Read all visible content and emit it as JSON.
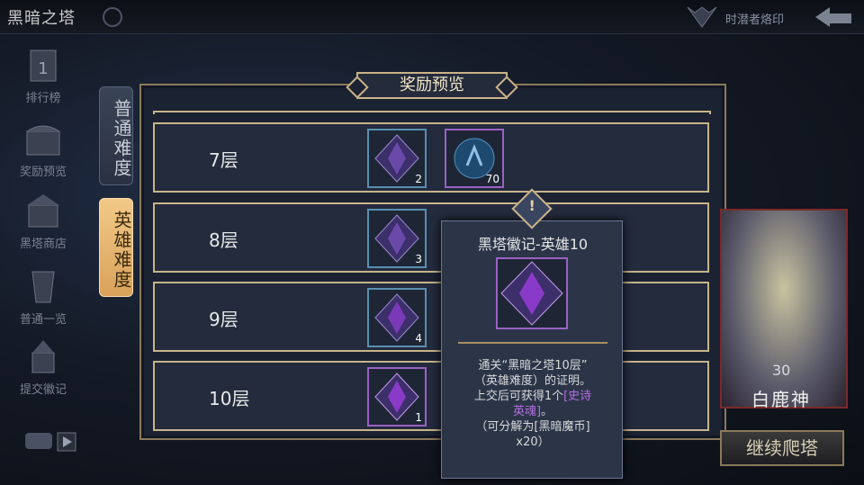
{
  "header": {
    "title": "黑暗之塔",
    "seal_label": "时潜者烙印"
  },
  "sidebar": [
    {
      "label": "排行榜",
      "icon": "ranking-icon"
    },
    {
      "label": "奖励预览",
      "icon": "chest-icon"
    },
    {
      "label": "黑塔商店",
      "icon": "shop-icon"
    },
    {
      "label": "普通一览",
      "icon": "overview-icon"
    },
    {
      "label": "提交徽记",
      "icon": "submit-icon"
    }
  ],
  "tabs": {
    "normal": "普通难度",
    "hero": "英雄难度"
  },
  "panel": {
    "title": "奖励预览"
  },
  "rows": [
    {
      "floor": "7层",
      "items": [
        {
          "count": "2"
        },
        {
          "count": "70"
        }
      ]
    },
    {
      "floor": "8层",
      "items": [
        {
          "count": "3"
        }
      ]
    },
    {
      "floor": "9层",
      "items": [
        {
          "count": "4"
        }
      ]
    },
    {
      "floor": "10层",
      "items": [
        {
          "count": "1"
        }
      ]
    }
  ],
  "tooltip": {
    "mark": "!",
    "title": "黑塔徽记-英雄10",
    "desc_1": "通关“黑暗之塔10层”",
    "desc_2": "（英雄难度）的证明。",
    "desc_3": "上交后可获得1个",
    "desc_hl1": "[史诗",
    "desc_hl2": "英魂]",
    "desc_4": "。",
    "desc_5": "（可分解为[黑暗魔币]",
    "desc_6": "x20）"
  },
  "hero": {
    "level": "30",
    "name": "白鹿神"
  },
  "continue_label": "继续爬塔",
  "colors": {
    "gold": "#c9b388",
    "purple": "#9a62c4",
    "blue": "#5b8fb0"
  }
}
